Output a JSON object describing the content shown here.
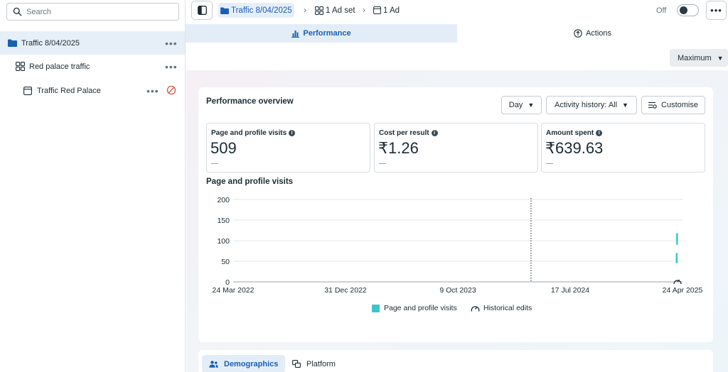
{
  "search": {
    "placeholder": "Search"
  },
  "tree": {
    "campaign": "Traffic 8/04/2025",
    "adset": "Red palace traffic",
    "ad": "Traffic Red Palace",
    "more": "•••"
  },
  "breadcrumb": {
    "campaign": "Traffic 8/04/2025",
    "adset": "1 Ad set",
    "ad": "1 Ad",
    "separator": "›"
  },
  "toggle": {
    "label": "Off",
    "state": "off"
  },
  "top_more": "•••",
  "tabs": [
    {
      "label": "Performance",
      "active": true
    },
    {
      "label": "Actions",
      "active": false
    }
  ],
  "date_range": {
    "value": "Maximum",
    "caret": "▼"
  },
  "overview": {
    "title": "Performance overview",
    "day_select": "Day",
    "activity_select": "Activity history: All",
    "customise": "Customise",
    "info_glyph": "i",
    "metrics": [
      {
        "label": "Page and profile visits",
        "value": "509",
        "delta": "—"
      },
      {
        "label": "Cost per result",
        "value": "₹1.26",
        "delta": "—"
      },
      {
        "label": "Amount spent",
        "value": "₹639.63",
        "delta": "—"
      }
    ]
  },
  "chart_data": {
    "type": "bar",
    "title": "Page and profile visits",
    "y_ticks": [
      "200",
      "150",
      "100",
      "50",
      "0"
    ],
    "ylim": [
      0,
      200
    ],
    "x_ticks": [
      "24 Mar 2022",
      "31 Dec 2022",
      "9 Oct 2023",
      "17 Jul 2024",
      "24 Apr 2025"
    ],
    "x_range": [
      "2022-03-24",
      "2025-04-24"
    ],
    "grid": true,
    "series": [
      {
        "name": "Page and profile visits",
        "color": "#3ec5c9",
        "points": [
          {
            "x": "2025-04-09",
            "low": 45,
            "high": 70
          },
          {
            "x": "2025-04-10",
            "low": 90,
            "high": 118
          }
        ]
      }
    ],
    "divider_date": "2024-04-09",
    "legend": [
      "Page and profile visits",
      "Historical edits"
    ],
    "legend_position": "bottom"
  },
  "bottom_tabs": [
    {
      "label": "Demographics",
      "active": true
    },
    {
      "label": "Platform",
      "active": false
    }
  ],
  "colors": {
    "accent": "#1a5fb4",
    "series": "#3ec5c9",
    "stop": "#e0533d"
  }
}
